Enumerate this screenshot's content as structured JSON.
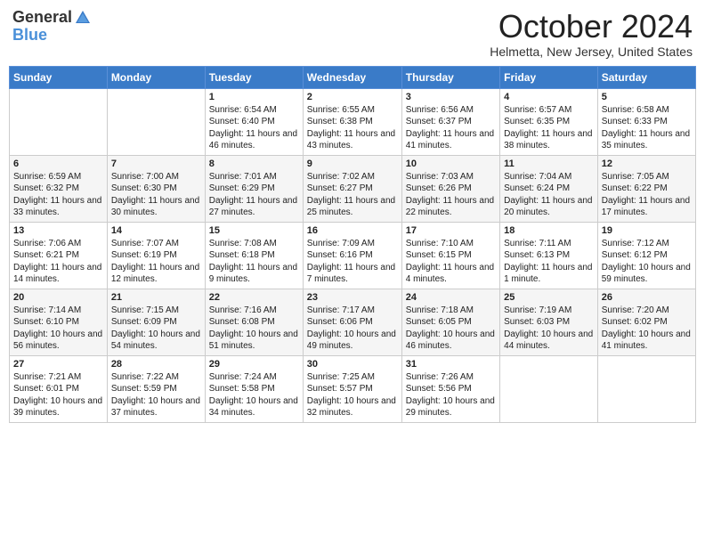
{
  "header": {
    "logo_general": "General",
    "logo_blue": "Blue",
    "month": "October 2024",
    "location": "Helmetta, New Jersey, United States"
  },
  "days": [
    "Sunday",
    "Monday",
    "Tuesday",
    "Wednesday",
    "Thursday",
    "Friday",
    "Saturday"
  ],
  "weeks": [
    [
      {
        "num": "",
        "content": ""
      },
      {
        "num": "",
        "content": ""
      },
      {
        "num": "1",
        "content": "Sunrise: 6:54 AM\nSunset: 6:40 PM\nDaylight: 11 hours and 46 minutes."
      },
      {
        "num": "2",
        "content": "Sunrise: 6:55 AM\nSunset: 6:38 PM\nDaylight: 11 hours and 43 minutes."
      },
      {
        "num": "3",
        "content": "Sunrise: 6:56 AM\nSunset: 6:37 PM\nDaylight: 11 hours and 41 minutes."
      },
      {
        "num": "4",
        "content": "Sunrise: 6:57 AM\nSunset: 6:35 PM\nDaylight: 11 hours and 38 minutes."
      },
      {
        "num": "5",
        "content": "Sunrise: 6:58 AM\nSunset: 6:33 PM\nDaylight: 11 hours and 35 minutes."
      }
    ],
    [
      {
        "num": "6",
        "content": "Sunrise: 6:59 AM\nSunset: 6:32 PM\nDaylight: 11 hours and 33 minutes."
      },
      {
        "num": "7",
        "content": "Sunrise: 7:00 AM\nSunset: 6:30 PM\nDaylight: 11 hours and 30 minutes."
      },
      {
        "num": "8",
        "content": "Sunrise: 7:01 AM\nSunset: 6:29 PM\nDaylight: 11 hours and 27 minutes."
      },
      {
        "num": "9",
        "content": "Sunrise: 7:02 AM\nSunset: 6:27 PM\nDaylight: 11 hours and 25 minutes."
      },
      {
        "num": "10",
        "content": "Sunrise: 7:03 AM\nSunset: 6:26 PM\nDaylight: 11 hours and 22 minutes."
      },
      {
        "num": "11",
        "content": "Sunrise: 7:04 AM\nSunset: 6:24 PM\nDaylight: 11 hours and 20 minutes."
      },
      {
        "num": "12",
        "content": "Sunrise: 7:05 AM\nSunset: 6:22 PM\nDaylight: 11 hours and 17 minutes."
      }
    ],
    [
      {
        "num": "13",
        "content": "Sunrise: 7:06 AM\nSunset: 6:21 PM\nDaylight: 11 hours and 14 minutes."
      },
      {
        "num": "14",
        "content": "Sunrise: 7:07 AM\nSunset: 6:19 PM\nDaylight: 11 hours and 12 minutes."
      },
      {
        "num": "15",
        "content": "Sunrise: 7:08 AM\nSunset: 6:18 PM\nDaylight: 11 hours and 9 minutes."
      },
      {
        "num": "16",
        "content": "Sunrise: 7:09 AM\nSunset: 6:16 PM\nDaylight: 11 hours and 7 minutes."
      },
      {
        "num": "17",
        "content": "Sunrise: 7:10 AM\nSunset: 6:15 PM\nDaylight: 11 hours and 4 minutes."
      },
      {
        "num": "18",
        "content": "Sunrise: 7:11 AM\nSunset: 6:13 PM\nDaylight: 11 hours and 1 minute."
      },
      {
        "num": "19",
        "content": "Sunrise: 7:12 AM\nSunset: 6:12 PM\nDaylight: 10 hours and 59 minutes."
      }
    ],
    [
      {
        "num": "20",
        "content": "Sunrise: 7:14 AM\nSunset: 6:10 PM\nDaylight: 10 hours and 56 minutes."
      },
      {
        "num": "21",
        "content": "Sunrise: 7:15 AM\nSunset: 6:09 PM\nDaylight: 10 hours and 54 minutes."
      },
      {
        "num": "22",
        "content": "Sunrise: 7:16 AM\nSunset: 6:08 PM\nDaylight: 10 hours and 51 minutes."
      },
      {
        "num": "23",
        "content": "Sunrise: 7:17 AM\nSunset: 6:06 PM\nDaylight: 10 hours and 49 minutes."
      },
      {
        "num": "24",
        "content": "Sunrise: 7:18 AM\nSunset: 6:05 PM\nDaylight: 10 hours and 46 minutes."
      },
      {
        "num": "25",
        "content": "Sunrise: 7:19 AM\nSunset: 6:03 PM\nDaylight: 10 hours and 44 minutes."
      },
      {
        "num": "26",
        "content": "Sunrise: 7:20 AM\nSunset: 6:02 PM\nDaylight: 10 hours and 41 minutes."
      }
    ],
    [
      {
        "num": "27",
        "content": "Sunrise: 7:21 AM\nSunset: 6:01 PM\nDaylight: 10 hours and 39 minutes."
      },
      {
        "num": "28",
        "content": "Sunrise: 7:22 AM\nSunset: 5:59 PM\nDaylight: 10 hours and 37 minutes."
      },
      {
        "num": "29",
        "content": "Sunrise: 7:24 AM\nSunset: 5:58 PM\nDaylight: 10 hours and 34 minutes."
      },
      {
        "num": "30",
        "content": "Sunrise: 7:25 AM\nSunset: 5:57 PM\nDaylight: 10 hours and 32 minutes."
      },
      {
        "num": "31",
        "content": "Sunrise: 7:26 AM\nSunset: 5:56 PM\nDaylight: 10 hours and 29 minutes."
      },
      {
        "num": "",
        "content": ""
      },
      {
        "num": "",
        "content": ""
      }
    ]
  ]
}
